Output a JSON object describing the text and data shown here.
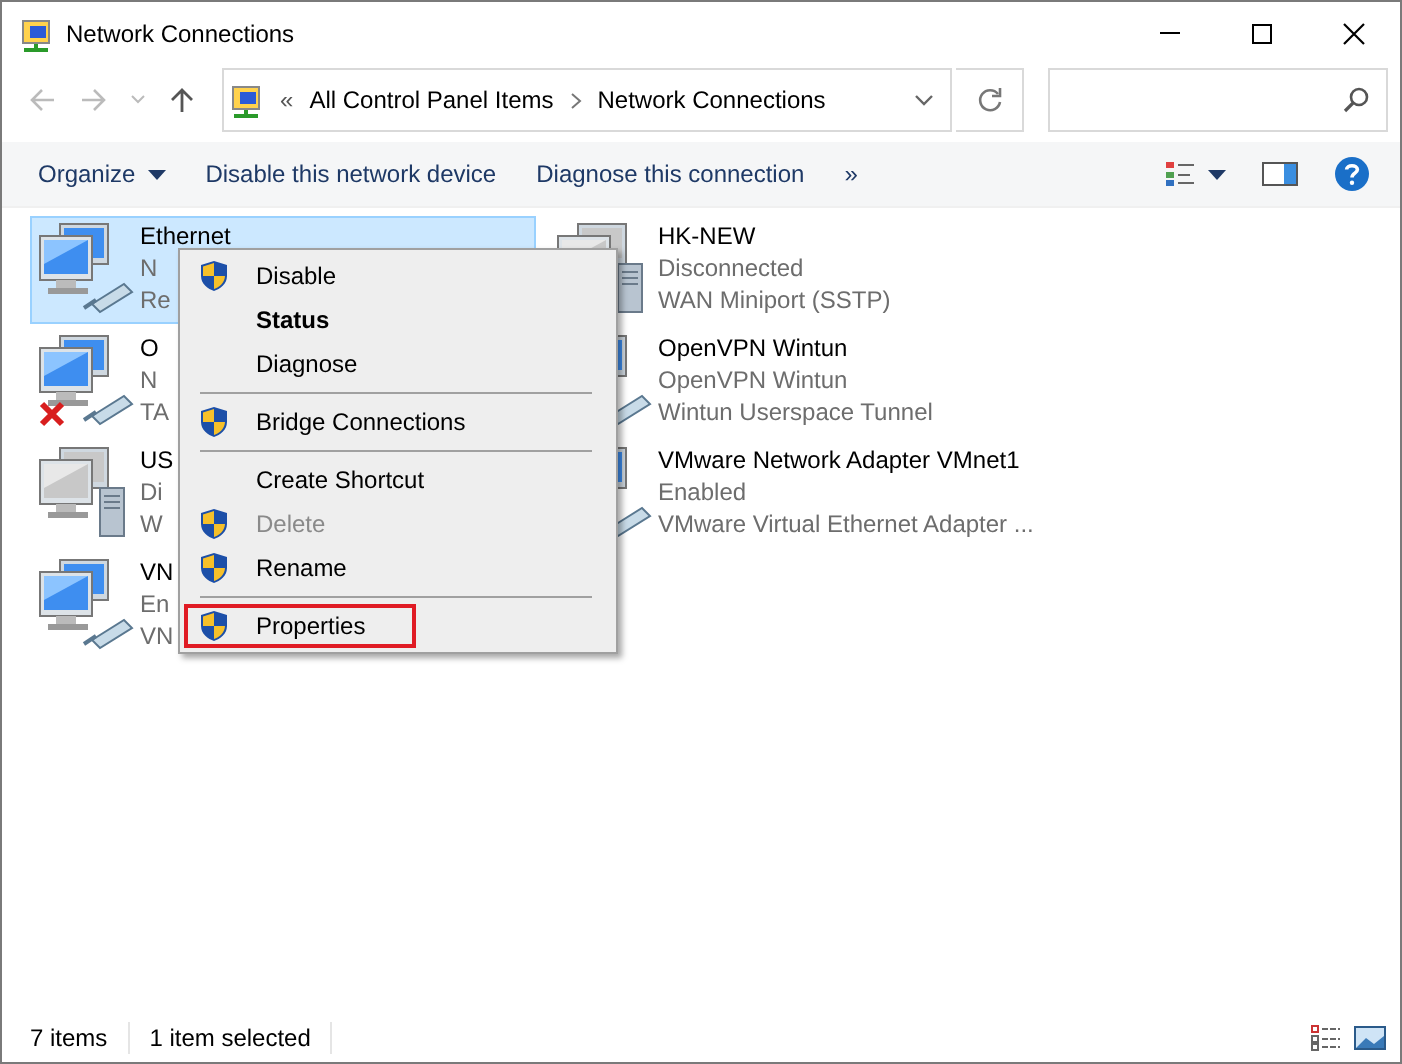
{
  "window": {
    "title": "Network Connections"
  },
  "address_bar": {
    "overflow": "«",
    "crumbs": [
      "All Control Panel Items",
      "Network Connections"
    ]
  },
  "toolbar": {
    "items": [
      {
        "label": "Organize",
        "dropdown": true
      },
      {
        "label": "Disable this network device",
        "dropdown": false
      },
      {
        "label": "Diagnose this connection",
        "dropdown": false
      },
      {
        "label": "»",
        "dropdown": false
      }
    ]
  },
  "connections": [
    {
      "kind": "wired",
      "name": "Ethernet",
      "status": "N",
      "device": "Re",
      "selected": true
    },
    {
      "kind": "wan",
      "name": "HK-NEW",
      "status": "Disconnected",
      "device": "WAN Miniport (SSTP)",
      "selected": false
    },
    {
      "kind": "wired-unplugged",
      "name": "O",
      "status": "N",
      "device": "TA",
      "selected": false
    },
    {
      "kind": "wired",
      "name": "OpenVPN Wintun",
      "status": "OpenVPN Wintun",
      "device": "Wintun Userspace Tunnel",
      "selected": false
    },
    {
      "kind": "wan",
      "name": "US",
      "status": "Di",
      "device": "W",
      "selected": false
    },
    {
      "kind": "wired",
      "name": "VMware Network Adapter VMnet1",
      "status": "Enabled",
      "device": "VMware Virtual Ethernet Adapter ...",
      "selected": false
    },
    {
      "kind": "wired",
      "name": "VN",
      "status": "En",
      "device": "VN",
      "selected": false
    }
  ],
  "context_menu": {
    "items": [
      {
        "kind": "item",
        "label": "Disable",
        "shield": true,
        "bold": false,
        "disabled": false,
        "highlighted": false
      },
      {
        "kind": "item",
        "label": "Status",
        "shield": false,
        "bold": true,
        "disabled": false,
        "highlighted": false
      },
      {
        "kind": "item",
        "label": "Diagnose",
        "shield": false,
        "bold": false,
        "disabled": false,
        "highlighted": false
      },
      {
        "kind": "separator"
      },
      {
        "kind": "item",
        "label": "Bridge Connections",
        "shield": true,
        "bold": false,
        "disabled": false,
        "highlighted": false
      },
      {
        "kind": "separator"
      },
      {
        "kind": "item",
        "label": "Create Shortcut",
        "shield": false,
        "bold": false,
        "disabled": false,
        "highlighted": false
      },
      {
        "kind": "item",
        "label": "Delete",
        "shield": true,
        "bold": false,
        "disabled": true,
        "highlighted": false
      },
      {
        "kind": "item",
        "label": "Rename",
        "shield": true,
        "bold": false,
        "disabled": false,
        "highlighted": false
      },
      {
        "kind": "separator"
      },
      {
        "kind": "item",
        "label": "Properties",
        "shield": true,
        "bold": false,
        "disabled": false,
        "highlighted": true
      }
    ]
  },
  "status_bar": {
    "items": [
      "7 items",
      "1 item selected"
    ]
  }
}
